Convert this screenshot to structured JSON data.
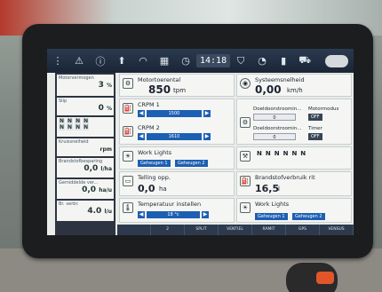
{
  "topbar": {
    "time": "14:18"
  },
  "left": {
    "motorvermogen_label": "Motorvermogen",
    "motorvermogen_value": "3",
    "motorvermogen_unit": "%",
    "slip_label": "Slip",
    "slip_value": "0",
    "slip_unit": "%",
    "n_row1": [
      "N",
      "N",
      "N",
      "N"
    ],
    "n_row2": [
      "N",
      "N",
      "N",
      "N"
    ],
    "kruissnelheid_label": "Kruissnelheid",
    "kruissnelheid_unit": "rpm",
    "brandstof_label": "Brandstofbesparing",
    "brandstof_value": "0,0",
    "brandstof_unit": "l/ha",
    "gemiddelde_label": "Gemiddelde ver...",
    "gemiddelde_value": "0,0",
    "gemiddelde_unit": "ha/u",
    "br_label": "Br. verbr.",
    "br_value": "4.0",
    "br_unit": "l/u"
  },
  "tiles": {
    "motortoerental_label": "Motortoerental",
    "motortoerental_value": "850",
    "motortoerental_unit": "tpm",
    "systeemsnelheid_label": "Systeemsnelheid",
    "systeemsnelheid_value": "0,00",
    "systeemsnelheid_unit": "km/h",
    "crpm1_label": "CRPM 1",
    "crpm1_value": "1500",
    "crpm2_label": "CRPM 2",
    "crpm2_value": "1610",
    "doeldoorstroom1_label": "Doeldoorstroomin...",
    "doeldoorstroom1_value": "0",
    "doeldoorstroom2_label": "Doeldoorstroomin...",
    "doeldoorstroom2_value": "0",
    "motormodus_label": "Motormodus",
    "motormodus_value": "OFF",
    "timer_label": "Timer",
    "timer_value": "OFF",
    "worklights_label": "Work Lights",
    "geheugen1": "Geheugen 1",
    "geheugen2": "Geheugen 2",
    "n_tiles": [
      "N",
      "N",
      "N",
      "N",
      "N",
      "N"
    ],
    "telling_label": "Telling opp.",
    "telling_value": "0,0",
    "telling_unit": "ha",
    "brandstofverbruik_label": "Brandstofverbruik rit",
    "brandstofverbruik_value": "16,5",
    "brandstofverbruik_unit": "l",
    "temperatuur_label": "Temperatuur instellen",
    "temperatuur_value": "18 °c",
    "worklights2_label": "Work Lights",
    "geheugen1b": "Geheugen 1",
    "geheugen2b": "Geheugen 2"
  },
  "bottombar": [
    "",
    "2",
    "SPLIT",
    "VENTIEL",
    "RAMIT",
    "GPS",
    "VENSUS"
  ]
}
